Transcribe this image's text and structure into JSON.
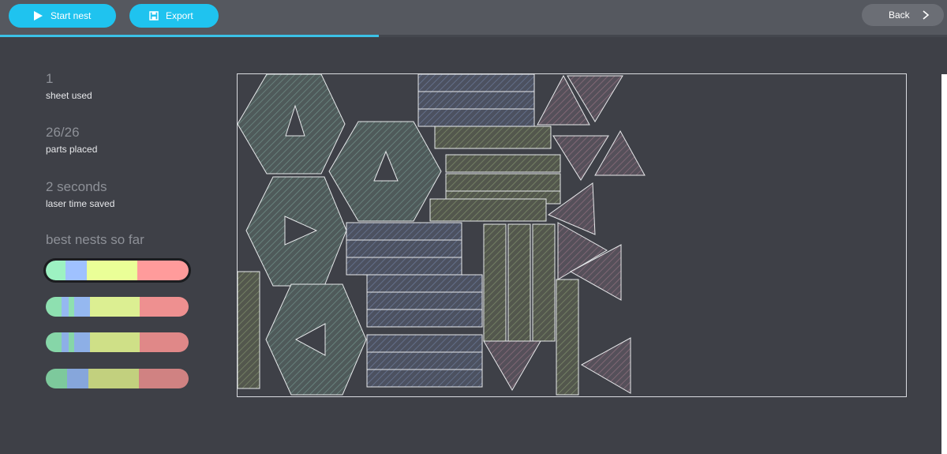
{
  "toolbar": {
    "start_label": "Start nest",
    "export_label": "Export",
    "back_label": "Back",
    "progress": 0.4,
    "accent": "#1fc3ef"
  },
  "icons": {
    "start": "play-icon",
    "export": "save-icon",
    "back": "chevron-right-icon"
  },
  "stats": {
    "sheets_value": "1",
    "sheets_label": "sheet used",
    "parts_value": "26/26",
    "parts_label": "parts placed",
    "time_value": "2 seconds",
    "time_label": "laser time saved"
  },
  "nests": {
    "title": "best nests so far",
    "items": [
      {
        "selected": true,
        "segments": [
          {
            "color": "#9df2c2",
            "w": 0.14
          },
          {
            "color": "#9fc1ff",
            "w": 0.15
          },
          {
            "color": "#eaff97",
            "w": 0.35
          },
          {
            "color": "#ff9b9b",
            "w": 0.36
          }
        ]
      },
      {
        "selected": false,
        "segments": [
          {
            "color": "#8ee0b0",
            "w": 0.11
          },
          {
            "color": "#95b8f0",
            "w": 0.05
          },
          {
            "color": "#8ee0b0",
            "w": 0.04
          },
          {
            "color": "#95b8f0",
            "w": 0.11
          },
          {
            "color": "#dcef92",
            "w": 0.35
          },
          {
            "color": "#ee9090",
            "w": 0.34
          }
        ]
      },
      {
        "selected": false,
        "segments": [
          {
            "color": "#86d6a8",
            "w": 0.11
          },
          {
            "color": "#8dafe6",
            "w": 0.05
          },
          {
            "color": "#86d6a8",
            "w": 0.04
          },
          {
            "color": "#8dafe6",
            "w": 0.11
          },
          {
            "color": "#cfe087",
            "w": 0.35
          },
          {
            "color": "#e08888",
            "w": 0.34
          }
        ]
      },
      {
        "selected": false,
        "segments": [
          {
            "color": "#7dc99c",
            "w": 0.15
          },
          {
            "color": "#86a6db",
            "w": 0.15
          },
          {
            "color": "#c2d07e",
            "w": 0.35
          },
          {
            "color": "#d08282",
            "w": 0.35
          }
        ]
      }
    ]
  },
  "sheet": {
    "border_color": "#d9dbe0",
    "part_colors": {
      "green": "#6e8c86",
      "blue": "#6a7896",
      "olive": "#7c8a6a",
      "pink": "#8c6e7c"
    }
  }
}
